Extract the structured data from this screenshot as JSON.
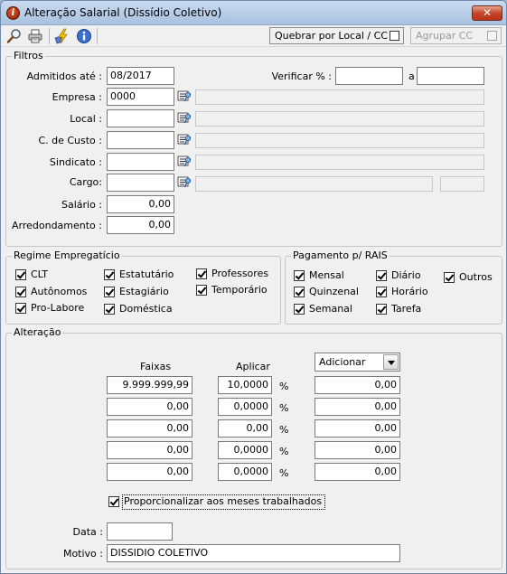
{
  "window": {
    "title": "Alteração Salarial (Dissídio Coletivo)",
    "close_label": "✕"
  },
  "toolbar": {
    "quebrar_label": "Quebrar por Local / CC",
    "agrupar_label": "Agrupar CC",
    "icons": [
      "search-icon",
      "printer-icon",
      "lightning-icon",
      "info-icon"
    ]
  },
  "filtros": {
    "legend": "Filtros",
    "admitidos_label": "Admitidos até :",
    "admitidos_value": "08/2017",
    "empresa_label": "Empresa :",
    "empresa_value": "0000",
    "local_label": "Local :",
    "local_value": "",
    "custo_label": "C. de Custo :",
    "custo_value": "",
    "sindicato_label": "Sindicato :",
    "sindicato_value": "",
    "cargo_label": "Cargo:",
    "cargo_value": "",
    "salario_label": "Salário :",
    "salario_value": "0,00",
    "arred_label": "Arredondamento :",
    "arred_value": "0,00",
    "verificar_label": "Verificar % :",
    "verificar_from": "",
    "a_label": "a",
    "verificar_to": ""
  },
  "regime": {
    "legend": "Regime Empregatício",
    "options": [
      {
        "label": "CLT",
        "checked": true
      },
      {
        "label": "Autônomos",
        "checked": true
      },
      {
        "label": "Pro-Labore",
        "checked": true
      },
      {
        "label": "Estatutário",
        "checked": true
      },
      {
        "label": "Estagiário",
        "checked": true
      },
      {
        "label": "Doméstica",
        "checked": true
      },
      {
        "label": "Professores",
        "checked": true
      },
      {
        "label": "Temporário",
        "checked": true
      }
    ]
  },
  "pagamento": {
    "legend": "Pagamento p/ RAIS",
    "options": [
      {
        "label": "Mensal",
        "checked": true
      },
      {
        "label": "Quinzenal",
        "checked": true
      },
      {
        "label": "Semanal",
        "checked": true
      },
      {
        "label": "Diário",
        "checked": true
      },
      {
        "label": "Horário",
        "checked": true
      },
      {
        "label": "Tarefa",
        "checked": true
      },
      {
        "label": "Outros",
        "checked": true
      }
    ]
  },
  "alteracao": {
    "legend": "Alteração",
    "faixas_header": "Faixas",
    "aplicar_header": "Aplicar",
    "mode_selected": "Adicionar",
    "percent_symbol": "%",
    "rows": [
      {
        "faixa": "9.999.999,99",
        "aplicar": "10,0000",
        "adicionar": "0,00"
      },
      {
        "faixa": "0,00",
        "aplicar": "0,0000",
        "adicionar": "0,00"
      },
      {
        "faixa": "0,00",
        "aplicar": "0,00",
        "adicionar": "0,00"
      },
      {
        "faixa": "0,00",
        "aplicar": "0,0000",
        "adicionar": "0,00"
      },
      {
        "faixa": "0,00",
        "aplicar": "0,0000",
        "adicionar": "0,00"
      }
    ],
    "proporcional_label": "Proporcionalizar aos meses trabalhados",
    "proporcional_checked": true,
    "data_label": "Data :",
    "data_value": "",
    "motivo_label": "Motivo :",
    "motivo_value": "DISSIDIO COLETIVO"
  }
}
